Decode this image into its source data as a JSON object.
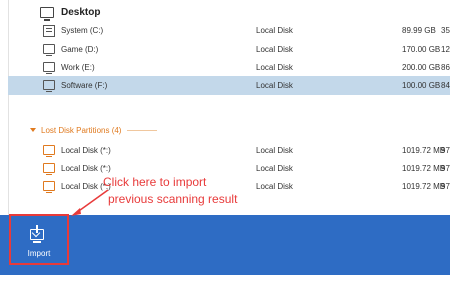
{
  "desktop": {
    "title": "Desktop",
    "rows": [
      {
        "name": "System (C:)",
        "type": "Local Disk",
        "size": "89.99 GB",
        "extra": "35",
        "icon": "system-disk-icon"
      },
      {
        "name": "Game (D:)",
        "type": "Local Disk",
        "size": "170.00 GB",
        "extra": "12",
        "icon": "disk-icon"
      },
      {
        "name": "Work (E:)",
        "type": "Local Disk",
        "size": "200.00 GB",
        "extra": "86",
        "icon": "disk-icon"
      },
      {
        "name": "Software (F:)",
        "type": "Local Disk",
        "size": "100.00 GB",
        "extra": "84",
        "icon": "disk-icon",
        "selected": true
      }
    ]
  },
  "lost": {
    "title": "Lost Disk Partitions (4)",
    "rows": [
      {
        "name": "Local Disk (*:)",
        "type": "Local Disk",
        "size": "1019.72 MB",
        "extra": "97"
      },
      {
        "name": "Local Disk (*:)",
        "type": "Local Disk",
        "size": "1019.72 MB",
        "extra": "97"
      },
      {
        "name": "Local Disk (*:)",
        "type": "Local Disk",
        "size": "1019.72 MB",
        "extra": "97"
      }
    ]
  },
  "toolbar": {
    "import_label": "Import"
  },
  "annotation": {
    "line1": "Click here to import",
    "line2": "previous scanning result"
  },
  "colors": {
    "accent_blue": "#2e6cc4",
    "selection": "#c3d8ea",
    "lost_orange": "#e07a1f",
    "annotation_red": "#e83a3a"
  }
}
